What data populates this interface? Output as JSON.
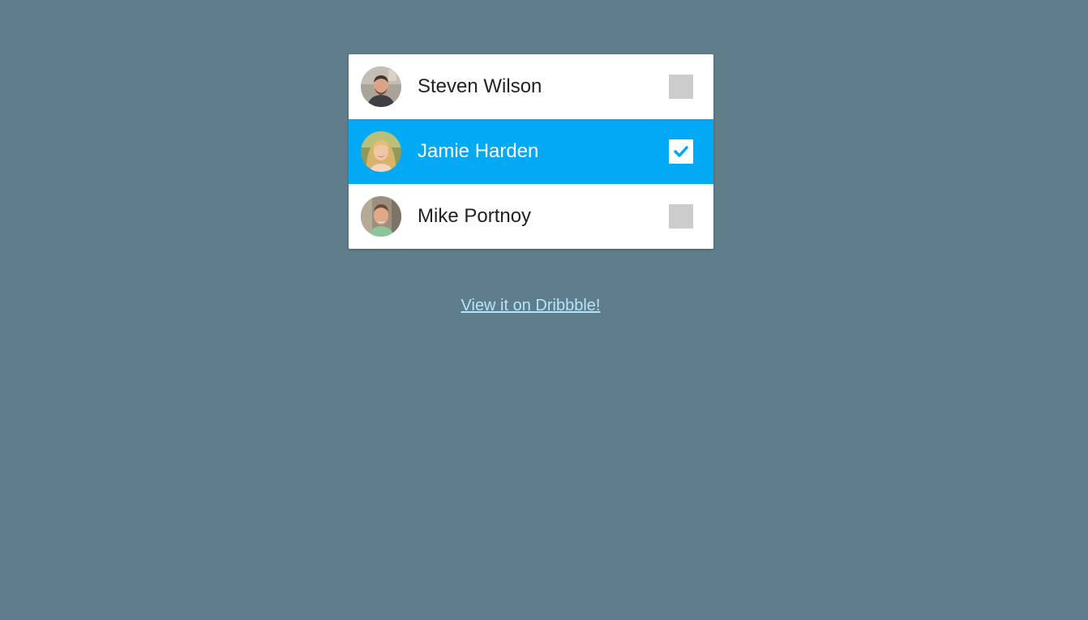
{
  "users": [
    {
      "name": "Steven Wilson",
      "selected": false,
      "avatar_icon": "man-portrait-avatar"
    },
    {
      "name": "Jamie Harden",
      "selected": true,
      "avatar_icon": "woman-portrait-avatar"
    },
    {
      "name": "Mike Portnoy",
      "selected": false,
      "avatar_icon": "man-portrait-avatar"
    }
  ],
  "link": {
    "label": "View it on Dribbble!"
  },
  "colors": {
    "background": "#607d8b",
    "selected_row": "#03a9f4",
    "checkbox_unchecked": "#cccccc",
    "link": "#b3e5fc"
  }
}
